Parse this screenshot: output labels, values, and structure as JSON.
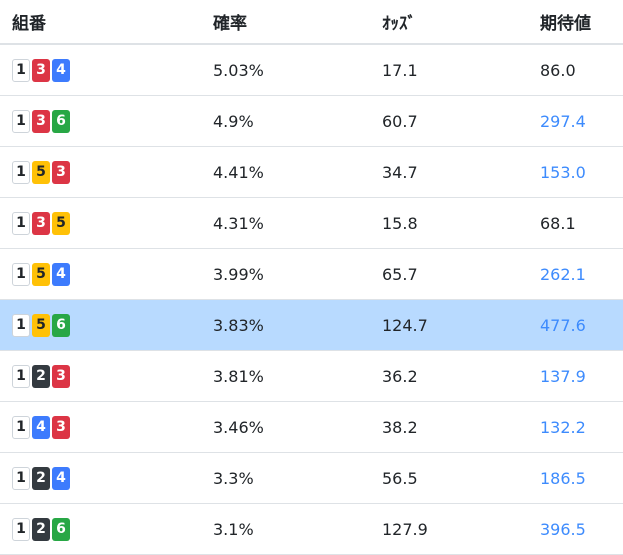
{
  "headers": {
    "combo": "組番",
    "prob": "確率",
    "odds": "ｵｯｽﾞ",
    "ev": "期待値"
  },
  "colors": {
    "boat_1": "#ffffff",
    "boat_2": "#343a40",
    "boat_3": "#dc3545",
    "boat_4": "#3d7bfd",
    "boat_5": "#ffc107",
    "boat_6": "#28a745",
    "highlight_row": "#b8daff",
    "high_ev_text": "#3d8bfd"
  },
  "rows": [
    {
      "boats": [
        "1",
        "3",
        "4"
      ],
      "prob": "5.03%",
      "odds": "17.1",
      "ev": "86.0",
      "ev_high": false,
      "highlighted": false
    },
    {
      "boats": [
        "1",
        "3",
        "6"
      ],
      "prob": "4.9%",
      "odds": "60.7",
      "ev": "297.4",
      "ev_high": true,
      "highlighted": false
    },
    {
      "boats": [
        "1",
        "5",
        "3"
      ],
      "prob": "4.41%",
      "odds": "34.7",
      "ev": "153.0",
      "ev_high": true,
      "highlighted": false
    },
    {
      "boats": [
        "1",
        "3",
        "5"
      ],
      "prob": "4.31%",
      "odds": "15.8",
      "ev": "68.1",
      "ev_high": false,
      "highlighted": false
    },
    {
      "boats": [
        "1",
        "5",
        "4"
      ],
      "prob": "3.99%",
      "odds": "65.7",
      "ev": "262.1",
      "ev_high": true,
      "highlighted": false
    },
    {
      "boats": [
        "1",
        "5",
        "6"
      ],
      "prob": "3.83%",
      "odds": "124.7",
      "ev": "477.6",
      "ev_high": true,
      "highlighted": true
    },
    {
      "boats": [
        "1",
        "2",
        "3"
      ],
      "prob": "3.81%",
      "odds": "36.2",
      "ev": "137.9",
      "ev_high": true,
      "highlighted": false
    },
    {
      "boats": [
        "1",
        "4",
        "3"
      ],
      "prob": "3.46%",
      "odds": "38.2",
      "ev": "132.2",
      "ev_high": true,
      "highlighted": false
    },
    {
      "boats": [
        "1",
        "2",
        "4"
      ],
      "prob": "3.3%",
      "odds": "56.5",
      "ev": "186.5",
      "ev_high": true,
      "highlighted": false
    },
    {
      "boats": [
        "1",
        "2",
        "6"
      ],
      "prob": "3.1%",
      "odds": "127.9",
      "ev": "396.5",
      "ev_high": true,
      "highlighted": false
    }
  ]
}
